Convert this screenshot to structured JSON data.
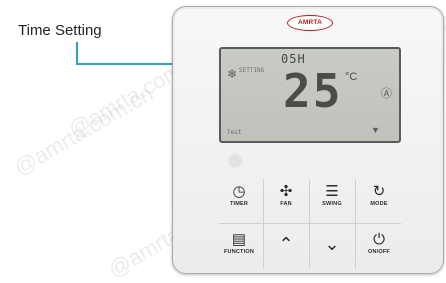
{
  "callout": {
    "label": "Time Setting"
  },
  "brand": {
    "name": "AMRTA"
  },
  "watermarks": [
    "@amrta.com.cn",
    "@amrta.com.cn",
    "@amrta.com.cn",
    "@amrta.com.cn",
    "@amrta.com.cn"
  ],
  "display": {
    "time": "05H",
    "temperature": "25",
    "unit": "°C",
    "mode_text": "SETTING",
    "bottom_text": "Test"
  },
  "buttons": [
    {
      "label": "TIMER",
      "icon": "timer-icon"
    },
    {
      "label": "FAN",
      "icon": "fan-icon"
    },
    {
      "label": "SWING",
      "icon": "swing-icon"
    },
    {
      "label": "MODE",
      "icon": "mode-icon"
    },
    {
      "label": "FUNCTION",
      "icon": "function-icon"
    },
    {
      "label": "",
      "icon": "up-arrow-icon"
    },
    {
      "label": "",
      "icon": "down-arrow-icon"
    },
    {
      "label": "ON/OFF",
      "icon": "power-icon"
    }
  ],
  "colors": {
    "callout_line": "#2aa2d6",
    "brand_red": "#c01818",
    "lcd_bg": "#c4c7c0"
  }
}
